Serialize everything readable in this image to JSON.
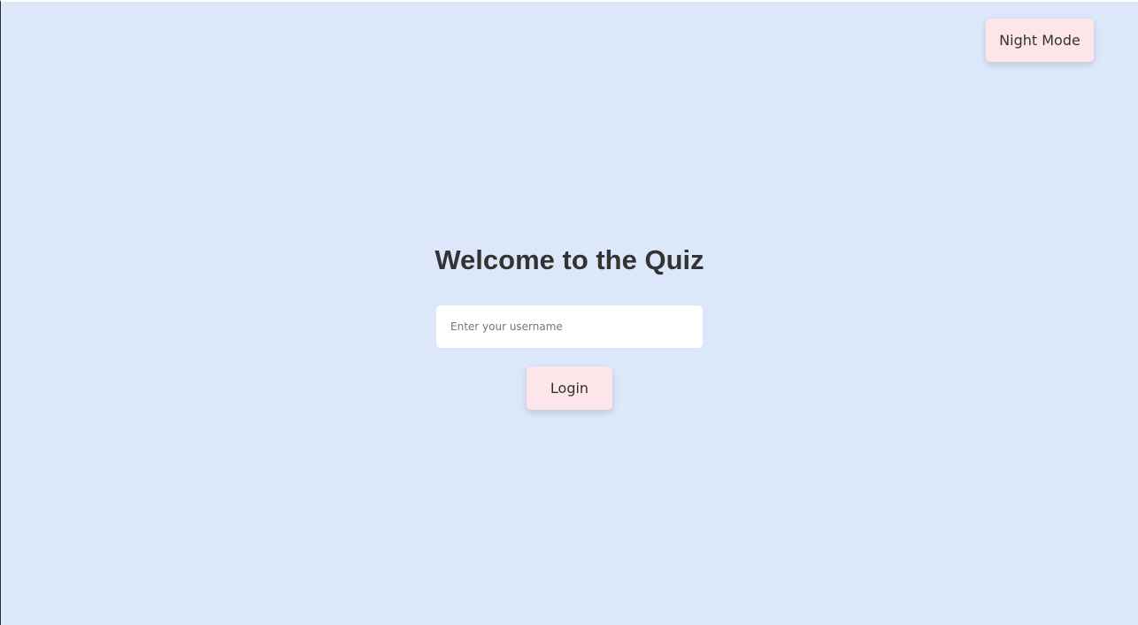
{
  "header": {
    "night_mode_label": "Night Mode"
  },
  "login": {
    "title": "Welcome to the Quiz",
    "username_placeholder": "Enter your username",
    "username_value": "",
    "login_label": "Login"
  },
  "colors": {
    "background": "#dde7fa",
    "button_background": "#fde6ea",
    "input_background": "#ffffff",
    "text": "#333333"
  }
}
